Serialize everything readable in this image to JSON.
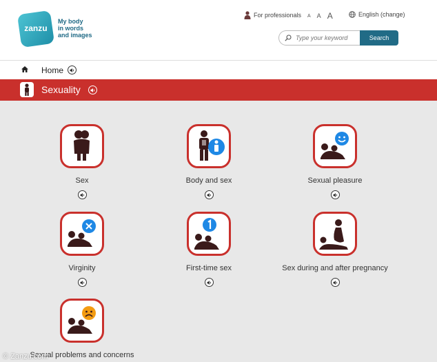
{
  "header": {
    "logo_text": "zanzu",
    "tagline": [
      "My body",
      "in words",
      "and images"
    ],
    "professionals_label": "For professionals",
    "font_sizes": [
      "A",
      "A",
      "A"
    ],
    "language_label": "English (change)",
    "search_placeholder": "Type your keyword",
    "search_button": "Search"
  },
  "breadcrumb": {
    "home_label": "Home"
  },
  "section": {
    "title": "Sexuality"
  },
  "tiles": [
    {
      "label": "Sex",
      "icon": "couple-hug-icon"
    },
    {
      "label": "Body and sex",
      "icon": "body-figure-icon"
    },
    {
      "label": "Sexual pleasure",
      "icon": "couple-happy-icon"
    },
    {
      "label": "Virginity",
      "icon": "couple-cross-icon"
    },
    {
      "label": "First-time sex",
      "icon": "couple-one-icon"
    },
    {
      "label": "Sex during and after pregnancy",
      "icon": "pregnant-couple-icon"
    },
    {
      "label": "Sexual problems and concerns",
      "icon": "couple-sad-icon"
    }
  ],
  "credit": "© Zanzu.com",
  "colors": {
    "accent_red": "#c9302c",
    "brand_teal": "#216b86",
    "blue_badge": "#1e88e5",
    "orange_badge": "#f39c12"
  }
}
